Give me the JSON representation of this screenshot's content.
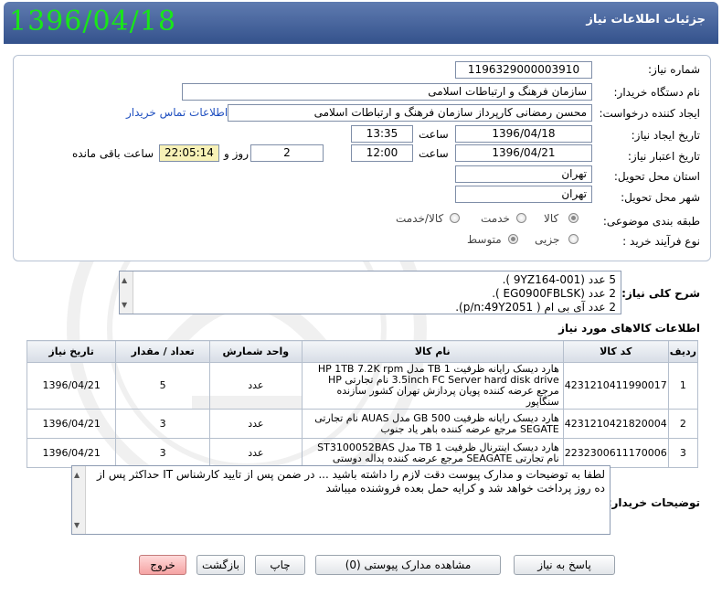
{
  "window": {
    "title": "جزئیات اطلاعات نیاز",
    "big_date": "1396/04/18"
  },
  "form": {
    "need_number": {
      "label": "شماره نیاز:",
      "value": "1196329000003910"
    },
    "buyer_org": {
      "label": "نام دستگاه خریدار:",
      "value": "سازمان فرهنگ و ارتباطات اسلامی"
    },
    "requester": {
      "label": "ایجاد کننده درخواست:",
      "value": "محسن رمضانی  کارپرداز سازمان فرهنگ و ارتباطات اسلامی",
      "contact_link": "اطلاعات تماس خریدار"
    },
    "created": {
      "label": "تاریخ ایجاد نیاز:",
      "date": "1396/04/18",
      "time_label": "ساعت",
      "time": "13:35"
    },
    "validity": {
      "label": "تاریخ اعتبار نیاز:",
      "date": "1396/04/21",
      "time_label": "ساعت",
      "time": "12:00",
      "days": "2",
      "days_label": "روز و",
      "remaining": "22:05:14",
      "remaining_label": "ساعت باقی مانده"
    },
    "province": {
      "label": "استان محل تحویل:",
      "value": "تهران"
    },
    "city": {
      "label": "شهر محل تحویل:",
      "value": "تهران"
    },
    "category": {
      "label": "طبقه بندی موضوعی:",
      "options": [
        "کالا",
        "خدمت",
        "کالا/خدمت"
      ],
      "selected": "کالا"
    },
    "process": {
      "label": "نوع فرآیند خرید :",
      "options": [
        "جزیی",
        "متوسط"
      ],
      "selected": "متوسط"
    }
  },
  "summary": {
    "label": "شرح کلی نیاز:",
    "lines": [
      "5 عدد  (9YZ164-001 ).",
      "2 عدد  (EG0900FBLSK ).",
      "2 عدد آی بی ام  ( p/n:49Y2051)."
    ]
  },
  "goods": {
    "heading": "اطلاعات کالاهای مورد نیاز",
    "columns": [
      "ردیف",
      "کد کالا",
      "نام کالا",
      "واحد شمارش",
      "تعداد / مقدار",
      "تاریخ نیاز"
    ],
    "rows": [
      {
        "row": "1",
        "code": "4231210411990017",
        "name": "هارد دیسک رایانه ظرفیت 1 TB مدل HP 1TB 7.2K rpm 3.5inch FC Server hard disk drive نام تجارتی HP مرجع عرضه کننده پویان پردازش تهران کشور سازنده سنگاپور",
        "unit": "عدد",
        "qty": "5",
        "date": "1396/04/21"
      },
      {
        "row": "2",
        "code": "4231210421820004",
        "name": "هارد دیسک رایانه ظرفیت 500 GB مدل AUAS نام تجارتی SEGATE مرجع عرضه کننده باهر یاد جنوب",
        "unit": "عدد",
        "qty": "3",
        "date": "1396/04/21"
      },
      {
        "row": "3",
        "code": "2232300611170006",
        "name": "هارد دیسک اینترنال ظرفیت 1 TB مدل ST3100052BAS نام تجارتی SEAGATE مرجع عرضه کننده پداله دوستی",
        "unit": "عدد",
        "qty": "3",
        "date": "1396/04/21"
      }
    ]
  },
  "buyer_notes": {
    "label": "توضیحات خریدار:",
    "text": "لطفا به توضیحات و مدارک پیوست دقت لازم را داشته باشید ... در ضمن پس از تایید کارشناس IT حداکثر پس از ده روز پرداخت خواهد شد و کرایه حمل بعده فروشنده میباشد"
  },
  "buttons": {
    "reply": "پاسخ به نیاز",
    "attachments": "مشاهده مدارک پیوستی (0)",
    "print": "چاپ",
    "back": "بازگشت",
    "exit": "خروج"
  },
  "colors": {
    "title_bar": "#34528c",
    "big_date": "#19e619",
    "exit_button": "#f5a3a3",
    "link": "#2050c0"
  }
}
